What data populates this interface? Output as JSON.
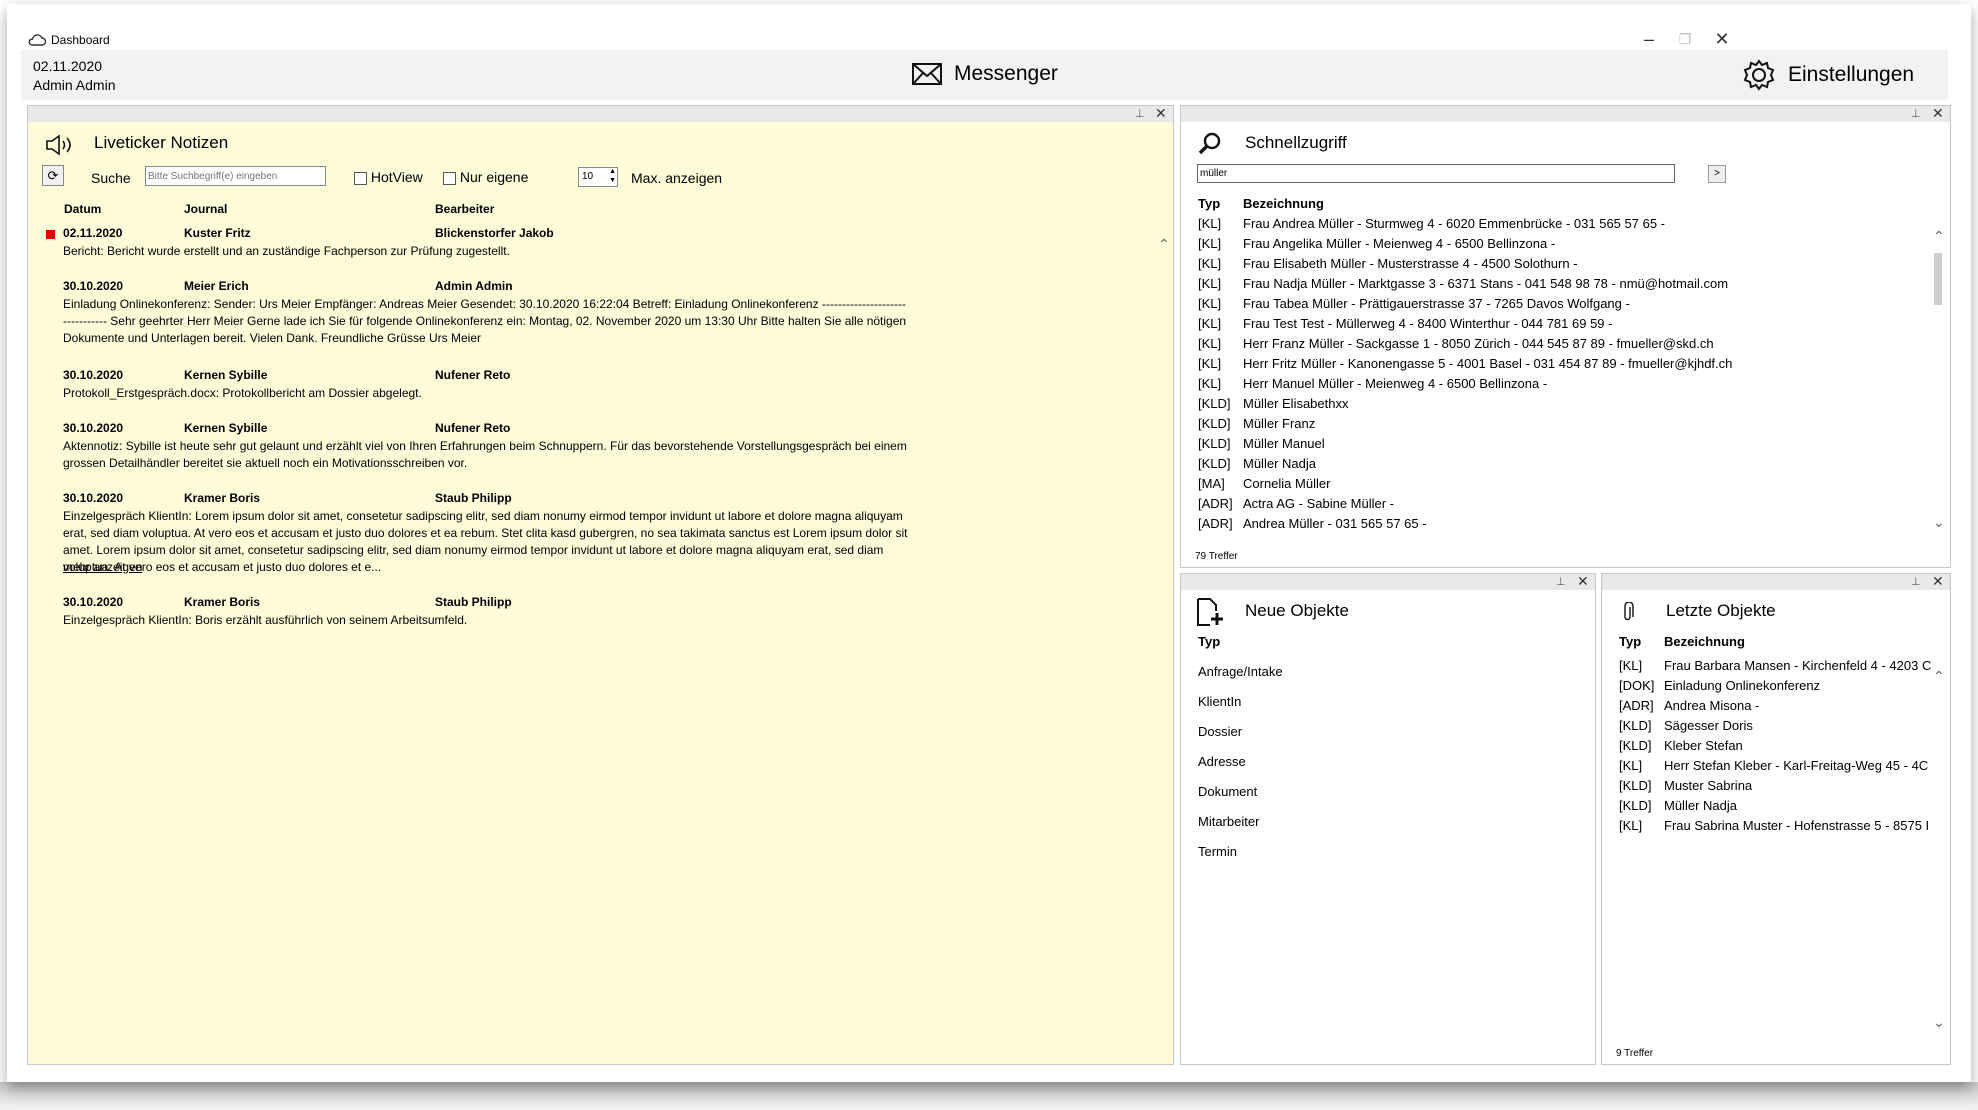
{
  "window": {
    "title": "Dashboard"
  },
  "header": {
    "date": "02.11.2020",
    "user": "Admin Admin",
    "messenger": "Messenger",
    "settings": "Einstellungen"
  },
  "liveticker": {
    "title": "Liveticker Notizen",
    "search_label": "Suche",
    "search_placeholder": "Bitte Suchbegriff(e) eingeben",
    "hotview": "HotView",
    "nur_eigene": "Nur eigene",
    "max_value": "10",
    "max_label": "Max. anzeigen",
    "columns": [
      "Datum",
      "Journal",
      "Bearbeiter"
    ],
    "entries": [
      {
        "date": "02.11.2020",
        "journal": "Kuster Fritz",
        "bearbeiter": "Blickenstorfer Jakob",
        "text": "Bericht: Bericht wurde erstellt und an zuständige Fachperson zur Prüfung zugestellt.",
        "more": ""
      },
      {
        "date": "30.10.2020",
        "journal": "Meier Erich",
        "bearbeiter": "Admin Admin",
        "text": "Einladung Onlinekonferenz: Sender: Urs Meier Empfänger: Andreas Meier Gesendet: 30.10.2020 16:22:04 Betreff: Einladung Onlinekonferenz -------------------------------- Sehr geehrter Herr Meier Gerne lade ich Sie für folgende Onlinekonferenz ein: Montag, 02. November 2020 um 13:30 Uhr Bitte halten Sie alle nötigen Dokumente und Unterlagen bereit. Vielen Dank. Freundliche Grüsse Urs Meier",
        "more": ""
      },
      {
        "date": "30.10.2020",
        "journal": "Kernen Sybille",
        "bearbeiter": "Nufener Reto",
        "text": "Protokoll_Erstgespräch.docx: Protokollbericht am Dossier abgelegt.",
        "more": ""
      },
      {
        "date": "30.10.2020",
        "journal": "Kernen Sybille",
        "bearbeiter": "Nufener Reto",
        "text": "Aktennotiz: Sybille ist heute sehr gut gelaunt und erzählt viel von Ihren Erfahrungen beim Schnuppern. Für das bevorstehende Vorstellungsgespräch bei einem grossen Detailhändler bereitet sie aktuell noch ein Motivationsschreiben vor.",
        "more": ""
      },
      {
        "date": "30.10.2020",
        "journal": "Kramer Boris",
        "bearbeiter": "Staub Philipp",
        "text": "Einzelgespräch KlientIn: Lorem ipsum dolor sit amet, consetetur sadipscing elitr, sed diam nonumy eirmod tempor invidunt ut labore et dolore magna aliquyam erat, sed diam voluptua. At vero eos et accusam et justo duo dolores et ea rebum. Stet clita kasd gubergren, no sea takimata sanctus est Lorem ipsum dolor sit amet. Lorem ipsum dolor sit amet, consetetur sadipscing elitr, sed diam nonumy eirmod tempor invidunt ut labore et dolore magna aliquyam erat, sed diam voluptua. At vero eos et accusam et justo duo dolores et e...",
        "more": "mehr anzeigen"
      },
      {
        "date": "30.10.2020",
        "journal": "Kramer Boris",
        "bearbeiter": "Staub Philipp",
        "text": "Einzelgespräch KlientIn: Boris erzählt ausführlich von seinem Arbeitsumfeld.",
        "more": ""
      }
    ]
  },
  "schnellzugriff": {
    "title": "Schnellzugriff",
    "query": "müller",
    "go": ">",
    "columns": [
      "Typ",
      "Bezeichnung"
    ],
    "rows": [
      {
        "typ": "[KL]",
        "bez": "Frau Andrea Müller - Sturmweg 4 - 6020 Emmenbrücke - 031 565 57 65 -"
      },
      {
        "typ": "[KL]",
        "bez": "Frau Angelika Müller - Meienweg 4 - 6500 Bellinzona -"
      },
      {
        "typ": "[KL]",
        "bez": "Frau Elisabeth Müller - Musterstrasse 4 - 4500 Solothurn -"
      },
      {
        "typ": "[KL]",
        "bez": "Frau Nadja Müller - Marktgasse 3 - 6371 Stans - 041 548 98 78 - nmü@hotmail.com"
      },
      {
        "typ": "[KL]",
        "bez": "Frau Tabea Müller - Prättigauerstrasse 37 - 7265 Davos Wolfgang -"
      },
      {
        "typ": "[KL]",
        "bez": "Frau Test Test - Müllerweg 4 - 8400 Winterthur - 044 781 69 59 -"
      },
      {
        "typ": "[KL]",
        "bez": "Herr Franz Müller - Sackgasse 1 - 8050 Zürich - 044 545 87 89 - fmueller@skd.ch"
      },
      {
        "typ": "[KL]",
        "bez": "Herr Fritz Müller - Kanonengasse 5 - 4001 Basel - 031 454 87 89 - fmueller@kjhdf.ch"
      },
      {
        "typ": "[KL]",
        "bez": "Herr Manuel Müller - Meienweg 4 - 6500 Bellinzona -"
      },
      {
        "typ": "[KLD]",
        "bez": "Müller Elisabethxx"
      },
      {
        "typ": "[KLD]",
        "bez": "Müller Franz"
      },
      {
        "typ": "[KLD]",
        "bez": "Müller Manuel"
      },
      {
        "typ": "[KLD]",
        "bez": "Müller Nadja"
      },
      {
        "typ": "[MA]",
        "bez": "Cornelia Müller"
      },
      {
        "typ": "[ADR]",
        "bez": "Actra AG - Sabine Müller -"
      },
      {
        "typ": "[ADR]",
        "bez": "Andrea Müller - 031 565 57 65 -"
      }
    ],
    "count": "79 Treffer"
  },
  "neue_objekte": {
    "title": "Neue Objekte",
    "column": "Typ",
    "items": [
      "Anfrage/Intake",
      "KlientIn",
      "Dossier",
      "Adresse",
      "Dokument",
      "Mitarbeiter",
      "Termin"
    ]
  },
  "letzte_objekte": {
    "title": "Letzte Objekte",
    "columns": [
      "Typ",
      "Bezeichnung"
    ],
    "rows": [
      {
        "typ": "[KL]",
        "bez": "Frau Barbara Mansen - Kirchenfeld 4 - 4203 C"
      },
      {
        "typ": "[DOK]",
        "bez": "Einladung Onlinekonferenz"
      },
      {
        "typ": "[ADR]",
        "bez": "Andrea Misona -"
      },
      {
        "typ": "[KLD]",
        "bez": "Sägesser Doris"
      },
      {
        "typ": "[KLD]",
        "bez": "Kleber Stefan"
      },
      {
        "typ": "[KL]",
        "bez": "Herr Stefan Kleber - Karl-Freitag-Weg 45 - 4C"
      },
      {
        "typ": "[KLD]",
        "bez": "Muster Sabrina"
      },
      {
        "typ": "[KLD]",
        "bez": "Müller Nadja"
      },
      {
        "typ": "[KL]",
        "bez": "Frau Sabrina Muster - Hofenstrasse 5 - 8575 I"
      }
    ],
    "count": "9 Treffer"
  }
}
